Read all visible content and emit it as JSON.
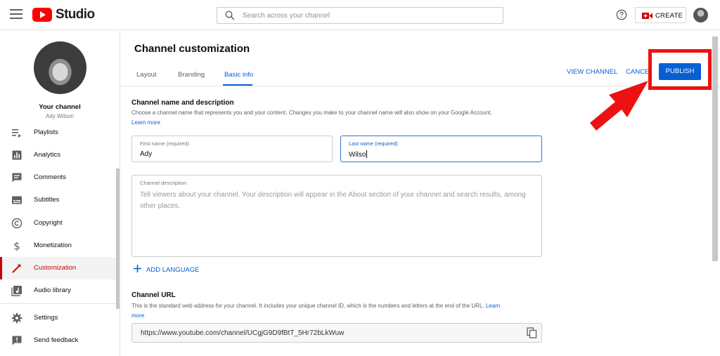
{
  "header": {
    "logo_text": "Studio",
    "search_placeholder": "Search across your channel",
    "create_label": "CREATE"
  },
  "sidebar": {
    "channel_title": "Your channel",
    "channel_owner": "Ady Wilson",
    "items": [
      {
        "label": "Playlists"
      },
      {
        "label": "Analytics"
      },
      {
        "label": "Comments"
      },
      {
        "label": "Subtitles"
      },
      {
        "label": "Copyright"
      },
      {
        "label": "Monetization"
      },
      {
        "label": "Customization"
      },
      {
        "label": "Audio library"
      },
      {
        "label": "Settings"
      },
      {
        "label": "Send feedback"
      }
    ]
  },
  "page": {
    "title": "Channel customization",
    "tabs": [
      {
        "label": "Layout"
      },
      {
        "label": "Branding"
      },
      {
        "label": "Basic info"
      }
    ],
    "view_channel": "VIEW CHANNEL",
    "cancel": "CANCEL",
    "publish": "PUBLISH"
  },
  "basic_info": {
    "section_title": "Channel name and description",
    "section_help": "Choose a channel name that represents you and your content. Changes you make to your channel name will also show on your Google Account.",
    "learn_more": "Learn more",
    "first_name_label": "First name (required)",
    "first_name_value": "Ady",
    "last_name_label": "Last name (required)",
    "last_name_value": "Wilso",
    "description_label": "Channel description",
    "description_placeholder": "Tell viewers about your channel. Your description will appear in the About section of your channel and search results, among other places.",
    "add_language": "ADD LANGUAGE",
    "url_title": "Channel URL",
    "url_help": "This is the standard web address for your channel. It includes your unique channel ID, which is the numbers and letters at the end of the URL.",
    "url_learn": "Learn",
    "url_more": "more",
    "url_value": "https://www.youtube.com/channel/UCgjG9D9fBtT_5Hr72bLkWuw"
  },
  "colors": {
    "accent_blue": "#065fd4",
    "active_red": "#cc0000",
    "annotation_red": "#ee1111"
  }
}
